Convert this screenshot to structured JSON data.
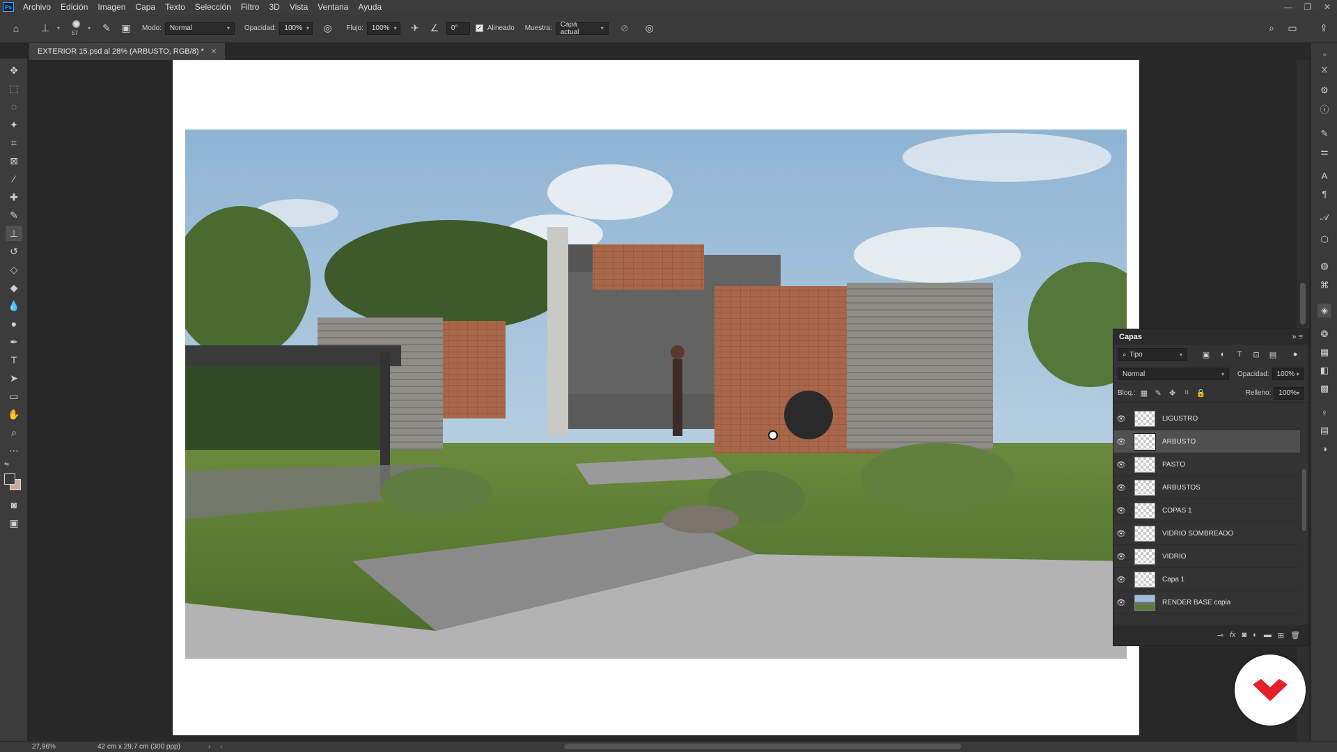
{
  "app": {
    "logo": "Ps"
  },
  "menu": [
    "Archivo",
    "Edición",
    "Imagen",
    "Capa",
    "Texto",
    "Selección",
    "Filtro",
    "3D",
    "Vista",
    "Ventana",
    "Ayuda"
  ],
  "options": {
    "brush_size": "57",
    "mode_label": "Modo:",
    "mode_value": "Normal",
    "opacity_label": "Opacidad:",
    "opacity_value": "100%",
    "flow_label": "Flujo:",
    "flow_value": "100%",
    "angle_value": "0°",
    "aligned_label": "Alineado",
    "sample_label": "Muestra:",
    "sample_value": "Capa actual"
  },
  "document": {
    "tab_title": "EXTERIOR 15.psd al 28% (ARBUSTO, RGB/8) *"
  },
  "layers_panel": {
    "title": "Capas",
    "filter_value": "Tipo",
    "blend_mode": "Normal",
    "opacity_label": "Opacidad:",
    "opacity_value": "100%",
    "lock_label": "Bloq.:",
    "fill_label": "Relleno:",
    "fill_value": "100%",
    "layers": [
      {
        "name": "LIGUSTRO",
        "selected": false
      },
      {
        "name": "ARBUSTO",
        "selected": true
      },
      {
        "name": "PASTO",
        "selected": false
      },
      {
        "name": "ARBUSTOS",
        "selected": false
      },
      {
        "name": "COPAS 1",
        "selected": false
      },
      {
        "name": "VIDRIO SOMBREADO",
        "selected": false
      },
      {
        "name": "VIDRIO",
        "selected": false
      },
      {
        "name": "Capa 1",
        "selected": false
      },
      {
        "name": "RENDER BASE copia",
        "selected": false
      }
    ]
  },
  "status": {
    "zoom": "27,96%",
    "doc_size": "42 cm x 29,7 cm (300 ppp)"
  },
  "colors": {
    "accent_logo": "#e4202a",
    "panel_bg": "#333333",
    "selected_layer": "#505050"
  }
}
